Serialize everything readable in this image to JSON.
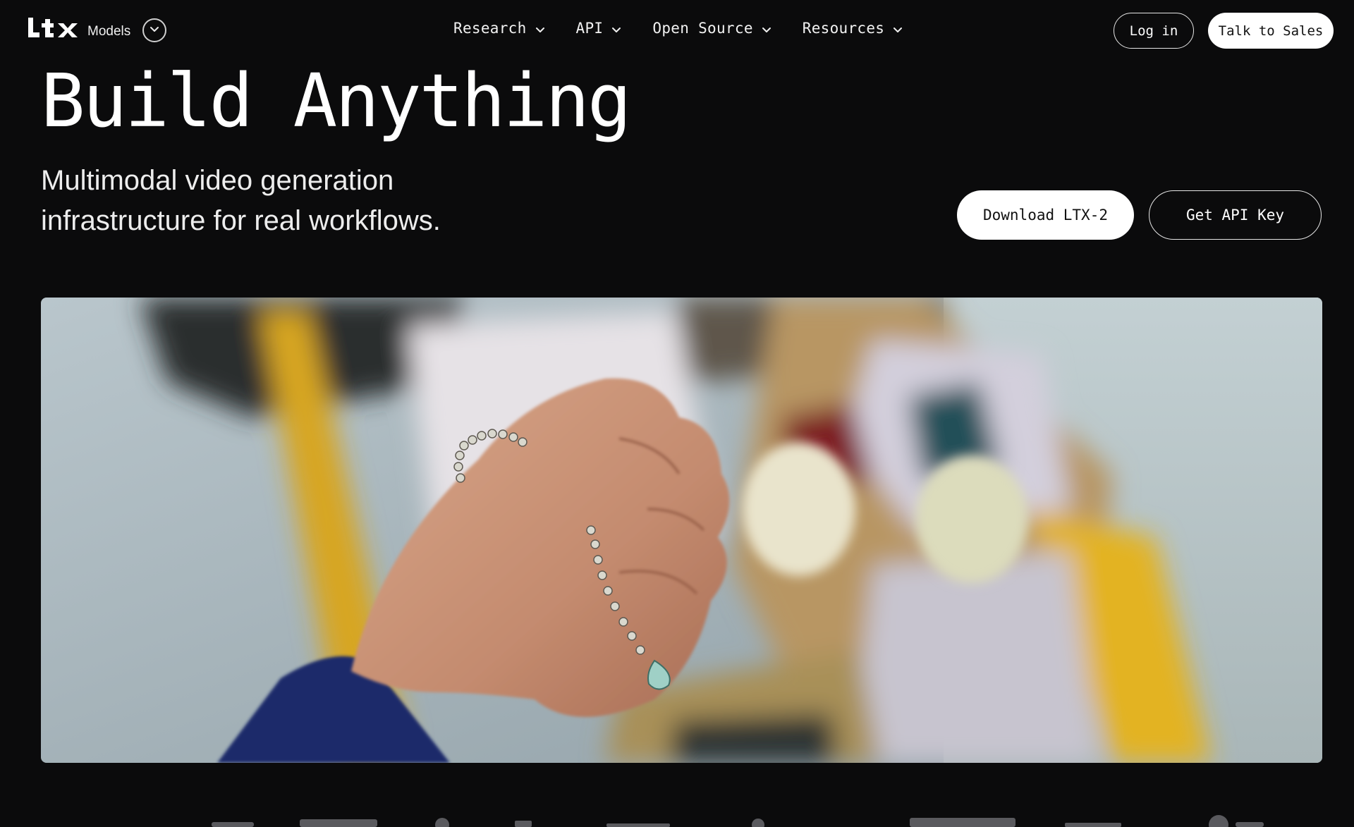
{
  "header": {
    "brand": {
      "logo_text": "LTX",
      "product": "Models",
      "toggle_icon": "chevron-down-icon"
    },
    "nav": [
      {
        "label": "Research",
        "icon": "chevron-down-icon"
      },
      {
        "label": "API",
        "icon": "chevron-down-icon"
      },
      {
        "label": "Open Source",
        "icon": "chevron-down-icon"
      },
      {
        "label": "Resources",
        "icon": "chevron-down-icon"
      }
    ],
    "login_label": "Log in",
    "sales_label": "Talk to Sales"
  },
  "hero": {
    "title": "Build Anything",
    "subtitle_line1": "Multimodal video generation",
    "subtitle_line2": "infrastructure for real workflows.",
    "primary_cta": "Download LTX-2",
    "secondary_cta": "Get API Key"
  },
  "media": {
    "alt": "hero-video"
  },
  "colors": {
    "background": "#0b0b0c",
    "text": "#ffffff",
    "button_fill": "#ffffff",
    "button_text": "#111111"
  }
}
